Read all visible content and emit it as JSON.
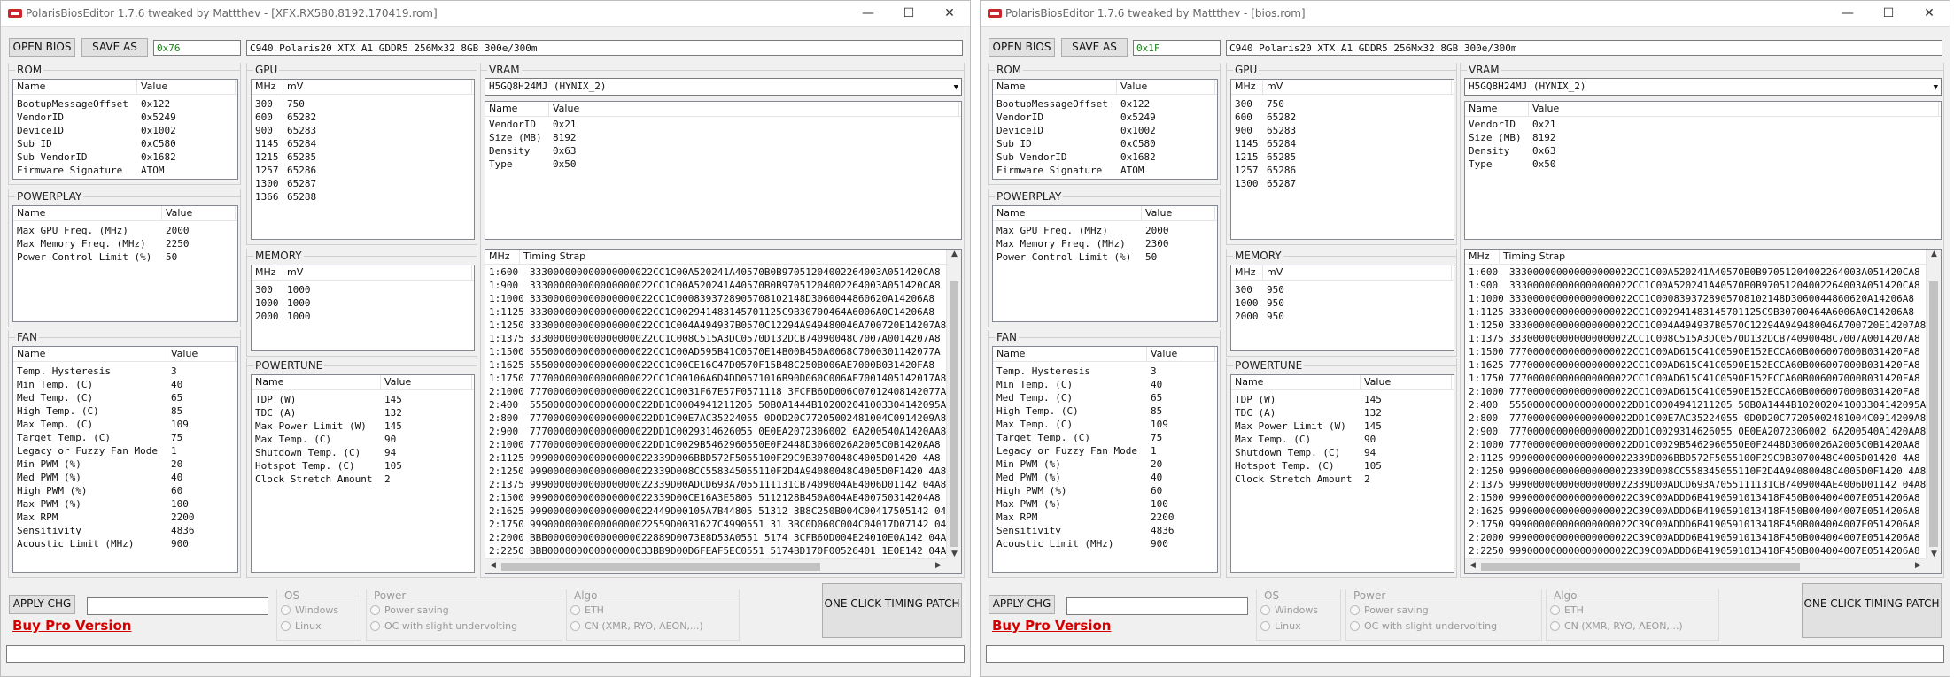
{
  "windows": [
    {
      "title": "PolarisBiosEditor 1.7.6 tweaked by Mattthev - [XFX.RX580.8192.170419.rom]",
      "open_label": "OPEN BIOS",
      "save_label": "SAVE AS",
      "checksum": "0x76",
      "description": "C940 Polaris20 XTX A1 GDDR5 256Mx32 8GB 300e/300m",
      "rom": {
        "label": "ROM",
        "headers": [
          "Name",
          "Value"
        ],
        "rows": [
          [
            "BootupMessageOffset",
            "0x122"
          ],
          [
            "VendorID",
            "0x5249"
          ],
          [
            "DeviceID",
            "0x1002"
          ],
          [
            "Sub ID",
            "0xC580"
          ],
          [
            "Sub VendorID",
            "0x1682"
          ],
          [
            "Firmware Signature",
            "ATOM"
          ]
        ]
      },
      "powerplay": {
        "label": "POWERPLAY",
        "headers": [
          "Name",
          "Value"
        ],
        "rows": [
          [
            "Max GPU Freq. (MHz)",
            "2000"
          ],
          [
            "Max Memory Freq. (MHz)",
            "2250"
          ],
          [
            "Power Control Limit (%)",
            "50"
          ]
        ]
      },
      "fan": {
        "label": "FAN",
        "headers": [
          "Name",
          "Value"
        ],
        "rows": [
          [
            "Temp. Hysteresis",
            "3"
          ],
          [
            "Min Temp. (C)",
            "40"
          ],
          [
            "Med Temp. (C)",
            "65"
          ],
          [
            "High Temp. (C)",
            "85"
          ],
          [
            "Max Temp. (C)",
            "109"
          ],
          [
            "Target Temp. (C)",
            "75"
          ],
          [
            "Legacy or Fuzzy Fan Mode",
            "1"
          ],
          [
            "Min PWM (%)",
            "20"
          ],
          [
            "Med PWM (%)",
            "40"
          ],
          [
            "High PWM (%)",
            "60"
          ],
          [
            "Max PWM (%)",
            "100"
          ],
          [
            "Max RPM",
            "2200"
          ],
          [
            "Sensitivity",
            "4836"
          ],
          [
            "Acoustic Limit (MHz)",
            "900"
          ]
        ]
      },
      "gpu": {
        "label": "GPU",
        "headers": [
          "MHz",
          "mV"
        ],
        "rows": [
          [
            "300",
            "750"
          ],
          [
            "600",
            "65282"
          ],
          [
            "900",
            "65283"
          ],
          [
            "1145",
            "65284"
          ],
          [
            "1215",
            "65285"
          ],
          [
            "1257",
            "65286"
          ],
          [
            "1300",
            "65287"
          ],
          [
            "1366",
            "65288"
          ]
        ]
      },
      "memory": {
        "label": "MEMORY",
        "headers": [
          "MHz",
          "mV"
        ],
        "rows": [
          [
            "300",
            "1000"
          ],
          [
            "1000",
            "1000"
          ],
          [
            "2000",
            "1000"
          ]
        ]
      },
      "powertune": {
        "label": "POWERTUNE",
        "headers": [
          "Name",
          "Value"
        ],
        "rows": [
          [
            "TDP (W)",
            "145"
          ],
          [
            "TDC (A)",
            "132"
          ],
          [
            "Max Power Limit (W)",
            "145"
          ],
          [
            "Max Temp. (C)",
            "90"
          ],
          [
            "Shutdown Temp. (C)",
            "94"
          ],
          [
            "Hotspot Temp. (C)",
            "105"
          ],
          [
            "Clock Stretch Amount",
            "2"
          ]
        ]
      },
      "vram": {
        "label": "VRAM",
        "selected": "H5GQ8H24MJ (HYNIX_2)",
        "headers": [
          "Name",
          "Value"
        ],
        "rows": [
          [
            "VendorID",
            "0x21"
          ],
          [
            "Size (MB)",
            "8192"
          ],
          [
            "Density",
            "0x63"
          ],
          [
            "Type",
            "0x50"
          ]
        ]
      },
      "timing": {
        "headers": [
          "MHz",
          "Timing Strap"
        ],
        "rows": [
          [
            "1:600",
            "333000000000000000022CC1C00A520241A40570B0B97051204002264003A051420CA8"
          ],
          [
            "1:900",
            "333000000000000000022CC1C00A520241A40570B0B97051204002264003A051420CA8"
          ],
          [
            "1:1000",
            "333000000000000000022CC1C0008393728905708102148D3060044860620A14206A8"
          ],
          [
            "1:1125",
            "333000000000000000022CC1C002941483145701125C9B30700464A6006A0C14206A8"
          ],
          [
            "1:1250",
            "333000000000000000022CC1C004A494937B0570C12294A949480046A700720E14207A8"
          ],
          [
            "1:1375",
            "333000000000000000022CC1C008C515A3DC0570D132DCB74090048C7007A0014207A8"
          ],
          [
            "1:1500",
            "555000000000000000022CC1C00AD595B41C0570E14B00B450A0068C7000301142077A"
          ],
          [
            "1:1625",
            "555000000000000000022CC1C00CE16C47D0570F15B48C250B006AE7000B031420FA8"
          ],
          [
            "1:1750",
            "777000000000000000022CC1C00106A6D4DD0571016B90D060C006AE7001405142017A8"
          ],
          [
            "2:1000",
            "777000000000000000022CC1C0031F67E57F0571118 3FCFB60D006C07012408142077A8"
          ],
          [
            "2:400",
            "555000000000000000022DD1C0004941211205 50B0A1444B102002041003304142095A8"
          ],
          [
            "2:800",
            "777000000000000000022DD1C00E7AC35224055 0D0D20C77205002481004C0914209A8"
          ],
          [
            "2:900",
            "777000000000000000022DD1C0029314626055 0E0EA2072306002 6A200540A1420AA8"
          ],
          [
            "2:1000",
            "777000000000000000022DD1C0029B5462960550E0F2448D3060026A2005C0B1420AA8"
          ],
          [
            "2:1125",
            "999000000000000000022339D006BBD572F5055100F29C9B3070048C4005D01420 4A8"
          ],
          [
            "2:1250",
            "999000000000000000022339D008CC558345055110F2D4A94080048C4005D0F1420 4A8"
          ],
          [
            "2:1375",
            "999000000000000000022339D00ADCD693A7055111131CB7409004AE4006D01142 04A8"
          ],
          [
            "2:1500",
            "999000000000000000022339D00CE16A3E5805 5112128B450A004AE400750314204A8"
          ],
          [
            "2:1625",
            "999000000000000000022449D00105A7B44805 51312 3B8C250B004C00417505142 04A8"
          ],
          [
            "2:1750",
            "999000000000000000022559D0031627C4990551 31 3BC0D060C004C04017D07142 04A8"
          ],
          [
            "2:2000",
            "BBB000000000000000022889D0073E8D53A0551 5174 3CFB60D004E24010E0A142 04A8"
          ],
          [
            "2:2250",
            "BBB000000000000000033BB9D00D6FEAF5EC0551 5174BD170F00526401 1E0E142 04A8"
          ]
        ]
      },
      "apply_label": "APPLY CHG",
      "buy_label": "Buy Pro Version",
      "os": {
        "label": "OS",
        "options": [
          "Windows",
          "Linux"
        ]
      },
      "power": {
        "label": "Power",
        "options": [
          "Power saving",
          "OC with slight undervolting"
        ]
      },
      "algo": {
        "label": "Algo",
        "options": [
          "ETH",
          "CN (XMR, RYO, AEON,...)"
        ]
      },
      "oneclick_label": "ONE CLICK TIMING PATCH"
    },
    {
      "title": "PolarisBiosEditor 1.7.6 tweaked by Mattthev - [bios.rom]",
      "open_label": "OPEN BIOS",
      "save_label": "SAVE AS",
      "checksum": "0x1F",
      "description": "C940 Polaris20 XTX A1 GDDR5 256Mx32 8GB 300e/300m",
      "rom": {
        "label": "ROM",
        "headers": [
          "Name",
          "Value"
        ],
        "rows": [
          [
            "BootupMessageOffset",
            "0x122"
          ],
          [
            "VendorID",
            "0x5249"
          ],
          [
            "DeviceID",
            "0x1002"
          ],
          [
            "Sub ID",
            "0xC580"
          ],
          [
            "Sub VendorID",
            "0x1682"
          ],
          [
            "Firmware Signature",
            "ATOM"
          ]
        ]
      },
      "powerplay": {
        "label": "POWERPLAY",
        "headers": [
          "Name",
          "Value"
        ],
        "rows": [
          [
            "Max GPU Freq. (MHz)",
            "2000"
          ],
          [
            "Max Memory Freq. (MHz)",
            "2300"
          ],
          [
            "Power Control Limit (%)",
            "50"
          ]
        ]
      },
      "fan": {
        "label": "FAN",
        "headers": [
          "Name",
          "Value"
        ],
        "rows": [
          [
            "Temp. Hysteresis",
            "3"
          ],
          [
            "Min Temp. (C)",
            "40"
          ],
          [
            "Med Temp. (C)",
            "65"
          ],
          [
            "High Temp. (C)",
            "85"
          ],
          [
            "Max Temp. (C)",
            "109"
          ],
          [
            "Target Temp. (C)",
            "75"
          ],
          [
            "Legacy or Fuzzy Fan Mode",
            "1"
          ],
          [
            "Min PWM (%)",
            "20"
          ],
          [
            "Med PWM (%)",
            "40"
          ],
          [
            "High PWM (%)",
            "60"
          ],
          [
            "Max PWM (%)",
            "100"
          ],
          [
            "Max RPM",
            "2200"
          ],
          [
            "Sensitivity",
            "4836"
          ],
          [
            "Acoustic Limit (MHz)",
            "900"
          ]
        ]
      },
      "gpu": {
        "label": "GPU",
        "headers": [
          "MHz",
          "mV"
        ],
        "rows": [
          [
            "300",
            "750"
          ],
          [
            "600",
            "65282"
          ],
          [
            "900",
            "65283"
          ],
          [
            "1145",
            "65284"
          ],
          [
            "1215",
            "65285"
          ],
          [
            "1257",
            "65286"
          ],
          [
            "1300",
            "65287"
          ]
        ]
      },
      "memory": {
        "label": "MEMORY",
        "headers": [
          "MHz",
          "mV"
        ],
        "rows": [
          [
            "300",
            "950"
          ],
          [
            "1000",
            "950"
          ],
          [
            "2000",
            "950"
          ]
        ]
      },
      "powertune": {
        "label": "POWERTUNE",
        "headers": [
          "Name",
          "Value"
        ],
        "rows": [
          [
            "TDP (W)",
            "145"
          ],
          [
            "TDC (A)",
            "132"
          ],
          [
            "Max Power Limit (W)",
            "145"
          ],
          [
            "Max Temp. (C)",
            "90"
          ],
          [
            "Shutdown Temp. (C)",
            "94"
          ],
          [
            "Hotspot Temp. (C)",
            "105"
          ],
          [
            "Clock Stretch Amount",
            "2"
          ]
        ]
      },
      "vram": {
        "label": "VRAM",
        "selected": "H5GQ8H24MJ (HYNIX_2)",
        "headers": [
          "Name",
          "Value"
        ],
        "rows": [
          [
            "VendorID",
            "0x21"
          ],
          [
            "Size (MB)",
            "8192"
          ],
          [
            "Density",
            "0x63"
          ],
          [
            "Type",
            "0x50"
          ]
        ]
      },
      "timing": {
        "headers": [
          "MHz",
          "Timing Strap"
        ],
        "rows": [
          [
            "1:600",
            "333000000000000000022CC1C00A520241A40570B0B97051204002264003A051420CA8"
          ],
          [
            "1:900",
            "333000000000000000022CC1C00A520241A40570B0B97051204002264003A051420CA8"
          ],
          [
            "1:1000",
            "333000000000000000022CC1C0008393728905708102148D3060044860620A14206A8"
          ],
          [
            "1:1125",
            "333000000000000000022CC1C002941483145701125C9B30700464A6006A0C14206A8"
          ],
          [
            "1:1250",
            "333000000000000000022CC1C004A494937B0570C12294A949480046A700720E14207A8"
          ],
          [
            "1:1375",
            "333000000000000000022CC1C008C515A3DC0570D132DCB74090048C7007A0014207A8"
          ],
          [
            "1:1500",
            "777000000000000000022CC1C00AD615C41C0590E152ECCA60B006007000B031420FA8"
          ],
          [
            "1:1625",
            "777000000000000000022CC1C00AD615C41C0590E152ECCA60B006007000B031420FA8"
          ],
          [
            "1:1750",
            "777000000000000000022CC1C00AD615C41C0590E152ECCA60B006007000B031420FA8"
          ],
          [
            "2:1000",
            "777000000000000000022CC1C00AD615C41C0590E152ECCA60B006007000B031420FA8"
          ],
          [
            "2:400",
            "555000000000000000022DD1C0004941211205 50B0A1444B102002041003304142095A8"
          ],
          [
            "2:800",
            "777000000000000000022DD1C00E7AC35224055 0D0D20C77205002481004C0914209A8"
          ],
          [
            "2:900",
            "777000000000000000022DD1C0029314626055 0E0EA2072306002 6A200540A1420AA8"
          ],
          [
            "2:1000",
            "777000000000000000022DD1C0029B5462960550E0F2448D3060026A2005C0B1420AA8"
          ],
          [
            "2:1125",
            "999000000000000000022339D006BBD572F5055100F29C9B3070048C4005D01420 4A8"
          ],
          [
            "2:1250",
            "999000000000000000022339D008CC558345055110F2D4A94080048C4005D0F1420 4A8"
          ],
          [
            "2:1375",
            "999000000000000000022339D00ADCD693A7055111131CB7409004AE4006D01142 04A8"
          ],
          [
            "2:1500",
            "999000000000000000022C39C00ADDD6B4190591013418F450B004004007E0514206A8"
          ],
          [
            "2:1625",
            "999000000000000000022C39C00ADDD6B4190591013418F450B004004007E0514206A8"
          ],
          [
            "2:1750",
            "999000000000000000022C39C00ADDD6B4190591013418F450B004004007E0514206A8"
          ],
          [
            "2:2000",
            "999000000000000000022C39C00ADDD6B4190591013418F450B004004007E0514206A8"
          ],
          [
            "2:2250",
            "999000000000000000022C39C00ADDD6B4190591013418F450B004004007E0514206A8"
          ]
        ]
      },
      "apply_label": "APPLY CHG",
      "buy_label": "Buy Pro Version",
      "os": {
        "label": "OS",
        "options": [
          "Windows",
          "Linux"
        ]
      },
      "power": {
        "label": "Power",
        "options": [
          "Power saving",
          "OC with slight undervolting"
        ]
      },
      "algo": {
        "label": "Algo",
        "options": [
          "ETH",
          "CN (XMR, RYO, AEON,...)"
        ]
      },
      "oneclick_label": "ONE CLICK TIMING PATCH"
    }
  ]
}
